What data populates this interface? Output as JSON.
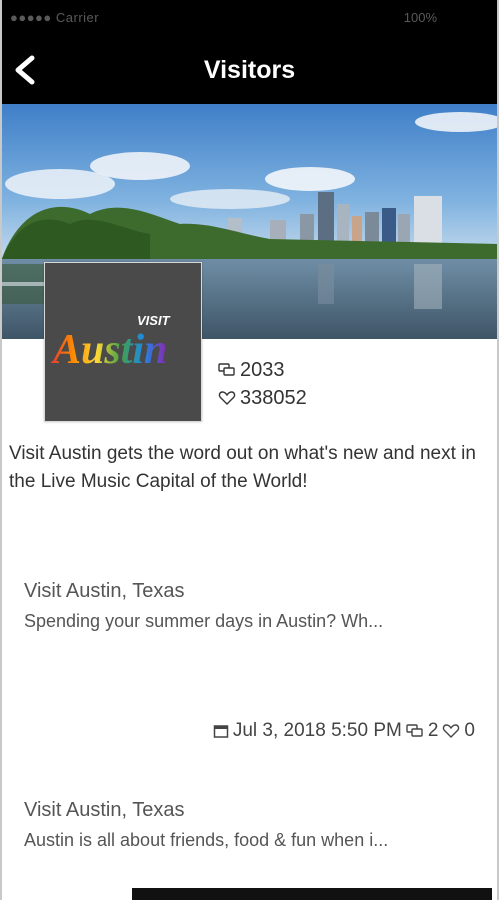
{
  "status": {
    "left": "●●●●● Carrier",
    "right": "100%"
  },
  "header": {
    "title": "Visitors"
  },
  "profile": {
    "logo_small": "VISIT",
    "logo_large": "Austin",
    "stats": {
      "comments": "2033",
      "likes": "338052"
    },
    "description": "Visit Austin gets the word out on what's new and next in the Live Music Capital of the World!"
  },
  "posts": [
    {
      "title": "Visit Austin, Texas",
      "excerpt": "Spending your summer days in Austin? Wh...",
      "date": "Jul 3, 2018 5:50 PM",
      "comments": "2",
      "likes": "0"
    },
    {
      "title": "Visit Austin, Texas",
      "excerpt": "Austin is all about friends, food & fun when i..."
    }
  ],
  "icons": {
    "back": "chevron-left-icon",
    "comments": "comments-icon",
    "likes": "heart-icon",
    "date": "calendar-icon"
  },
  "colors": {
    "header_bg": "#000000",
    "logo_bg": "#4a4a4a",
    "text": "#333333"
  }
}
